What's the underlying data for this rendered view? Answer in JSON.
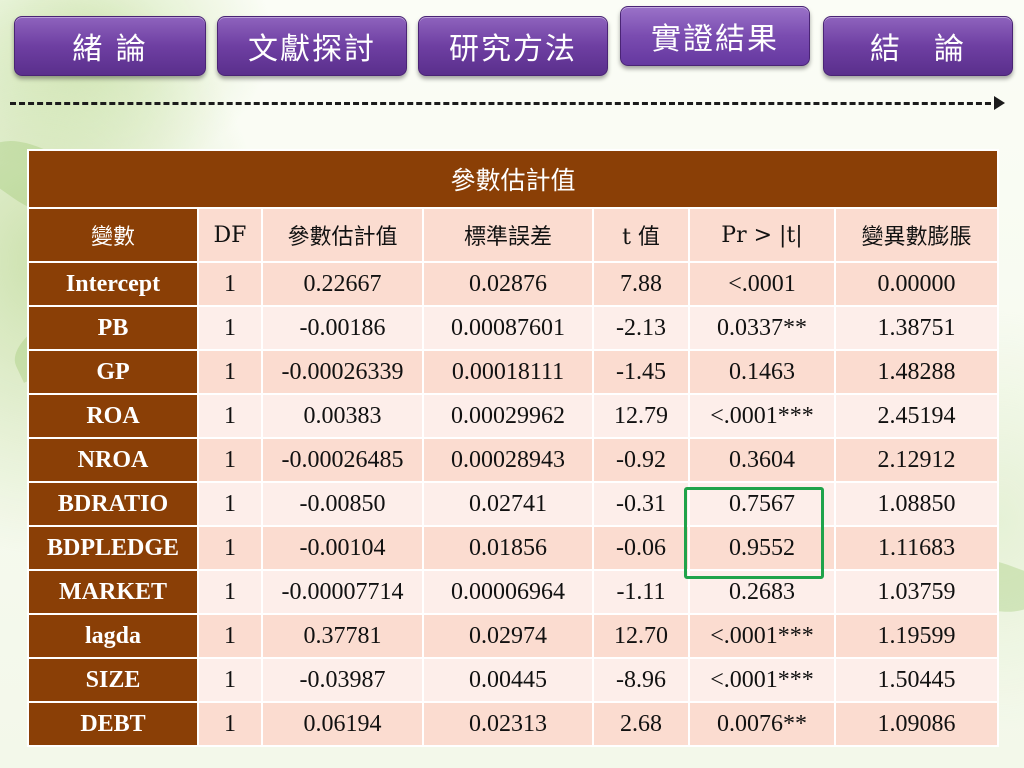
{
  "nav": {
    "items": [
      {
        "label": "緒 論"
      },
      {
        "label": "文獻探討"
      },
      {
        "label": "研究方法"
      },
      {
        "label": "實證結果"
      },
      {
        "label": "結　論"
      }
    ],
    "active_index": 3
  },
  "table": {
    "title": "參數估計值",
    "headers": [
      "變數",
      "DF",
      "參數估計值",
      "標準誤差",
      "t 值",
      "Pr > |t|",
      "變異數膨脹"
    ],
    "rows": [
      [
        "Intercept",
        "1",
        "0.22667",
        "0.02876",
        "7.88",
        "<.0001",
        "0.00000"
      ],
      [
        "PB",
        "1",
        "-0.00186",
        "0.00087601",
        "-2.13",
        "0.0337**",
        "1.38751"
      ],
      [
        "GP",
        "1",
        "-0.00026339",
        "0.00018111",
        "-1.45",
        "0.1463",
        "1.48288"
      ],
      [
        "ROA",
        "1",
        "0.00383",
        "0.00029962",
        "12.79",
        "<.0001***",
        "2.45194"
      ],
      [
        "NROA",
        "1",
        "-0.00026485",
        "0.00028943",
        "-0.92",
        "0.3604",
        "2.12912"
      ],
      [
        "BDRATIO",
        "1",
        "-0.00850",
        "0.02741",
        "-0.31",
        "0.7567",
        "1.08850"
      ],
      [
        "BDPLEDGE",
        "1",
        "-0.00104",
        "0.01856",
        "-0.06",
        "0.9552",
        "1.11683"
      ],
      [
        "MARKET",
        "1",
        "-0.00007714",
        "0.00006964",
        "-1.11",
        "0.2683",
        "1.03759"
      ],
      [
        "lagda",
        "1",
        "0.37781",
        "0.02974",
        "12.70",
        "<.0001***",
        "1.19599"
      ],
      [
        "SIZE",
        "1",
        "-0.03987",
        "0.00445",
        "-8.96",
        "<.0001***",
        "1.50445"
      ],
      [
        "DEBT",
        "1",
        "0.06194",
        "0.02313",
        "2.68",
        "0.0076**",
        "1.09086"
      ]
    ]
  },
  "colors": {
    "nav_purple": "#6e3fa2",
    "header_brown": "#8a3f06",
    "row_pink": "#fbdcd0",
    "row_light": "#fdeeea",
    "highlight_green": "#1fa34a"
  }
}
